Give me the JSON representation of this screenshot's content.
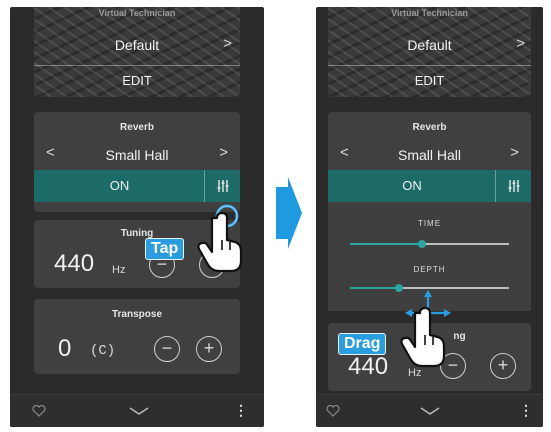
{
  "left": {
    "header_title": "Virtual Technician",
    "sound": {
      "name": "Default",
      "edit_label": "EDIT"
    },
    "reverb": {
      "title": "Reverb",
      "type": "Small Hall",
      "toggle_label": "ON"
    },
    "tuning": {
      "title": "Tuning",
      "value": "440",
      "unit": "Hz"
    },
    "transpose": {
      "title": "Transpose",
      "value": "0",
      "key": "(C)"
    },
    "annotation": "Tap"
  },
  "right": {
    "header_title": "Virtual Technician",
    "sound": {
      "name": "Default",
      "edit_label": "EDIT"
    },
    "reverb": {
      "title": "Reverb",
      "type": "Small Hall",
      "toggle_label": "ON",
      "sliders": [
        {
          "label": "TIME",
          "level": 0.45
        },
        {
          "label": "DEPTH",
          "level": 0.31
        }
      ]
    },
    "tuning": {
      "title_partial": "ng",
      "value": "440",
      "unit": "Hz"
    },
    "annotation": "Drag"
  },
  "symbols": {
    "prev": "<",
    "next": ">",
    "minus": "−",
    "plus": "+",
    "menu": "⋮"
  },
  "colors": {
    "accent_teal": "#1c6b68",
    "slider_teal": "#2aa7a0",
    "annotation_blue": "#2a9de0",
    "arrow_blue": "#1e9be0"
  },
  "icons": [
    "mixer-settings-icon",
    "heart-icon",
    "chevron-down-icon",
    "more-vertical-icon",
    "tap-hand-icon",
    "drag-hand-icon",
    "move-arrows-icon",
    "transition-arrow-icon"
  ]
}
